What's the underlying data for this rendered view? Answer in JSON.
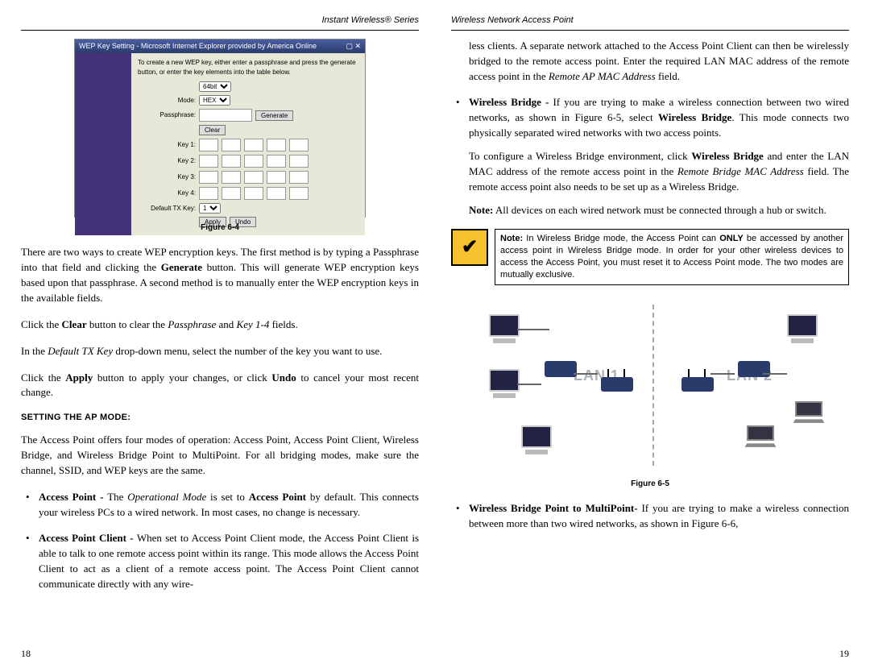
{
  "header": {
    "left": "Instant Wireless® Series",
    "right": "Wireless Network Access Point"
  },
  "left_page": {
    "wep_window_title": "WEP Key Setting - Microsoft Internet Explorer provided by America Online",
    "wep_instruction": "To create a new WEP key, either enter a passphrase and press the generate button, or enter the key elements into the table below.",
    "wep_labels": {
      "bit": "64bit",
      "mode": "Mode:",
      "mode_val": "HEX",
      "passphrase": "Passphrase:",
      "generate": "Generate",
      "clear": "Clear",
      "key1": "Key 1:",
      "key2": "Key 2:",
      "key3": "Key 3:",
      "key4": "Key 4:",
      "default_tx": "Default TX Key:",
      "apply": "Apply",
      "undo": "Undo"
    },
    "fig64": "Figure 6-4",
    "p1a": "There are two ways to create WEP encryption keys. The first method is by typing a Passphrase into that field and clicking the ",
    "p1b": "Generate",
    "p1c": " button. This will generate WEP encryption keys based upon that passphrase. A second method is to manually enter the WEP encryption keys in the available fields.",
    "p2a": "Click the ",
    "p2b": "Clear",
    "p2c": " button to clear the ",
    "p2d": "Passphrase",
    "p2e": " and ",
    "p2f": "Key 1-4",
    "p2g": " fields.",
    "p3a": "In the ",
    "p3b": "Default TX Key",
    "p3c": " drop-down menu, select the number of the key you want to use.",
    "p4a": "Click the ",
    "p4b": "Apply",
    "p4c": " button to apply your changes, or click ",
    "p4d": "Undo",
    "p4e": " to cancel your most recent change.",
    "section": "SETTING THE AP MODE:",
    "p5": "The Access Point offers four modes of operation: Access Point, Access Point Client, Wireless Bridge, and Wireless Bridge Point to MultiPoint. For all bridging modes, make sure the channel, SSID, and WEP keys are the same.",
    "b1a": "Access Point - ",
    "b1b": "The ",
    "b1c": "Operational Mode",
    "b1d": " is set to ",
    "b1e": "Access Point",
    "b1f": " by default. This connects your wireless PCs to a wired network. In most cases, no change is necessary.",
    "b2a": "Access Point Client - ",
    "b2b": "When set to Access Point Client mode, the Access Point Client is able to talk to one remote access point within its range. This mode allows the Access Point Client to act as a client of a remote access point. The Access Point Client cannot communicate directly with any wire-",
    "pagenum": "18"
  },
  "right_page": {
    "cont1a": "less clients. A separate network attached to the Access Point Client can then be wirelessly bridged to the remote access point. Enter the required LAN MAC address of the remote access point in the ",
    "cont1b": "Remote AP MAC Address",
    "cont1c": " field.",
    "b3a": "Wireless Bridge - ",
    "b3b": "If you are trying to make a wireless connection between two wired networks, as shown in Figure 6-5, select ",
    "b3c": "Wireless Bridge",
    "b3d": ". This mode connects two physically separated wired networks with two access points.",
    "b3p2a": "To configure a Wireless Bridge environment, click ",
    "b3p2b": "Wireless Bridge",
    "b3p2c": " and enter the LAN MAC address of the remote access point in the ",
    "b3p2d": "Remote Bridge MAC Address",
    "b3p2e": " field. The remote access point also needs to be set up as a Wireless Bridge.",
    "b3p3a": "Note:",
    "b3p3b": " All devices on each wired network must be connected through a hub or switch.",
    "warn_a": "Note:",
    "warn_b": " In Wireless Bridge mode, the Access Point can ",
    "warn_c": "ONLY",
    "warn_d": " be accessed by another access point in Wireless Bridge mode. In order for your other wireless devices to access the Access Point, you must reset it to Access Point mode. The two modes are mutually exclusive.",
    "lan1": "LAN 1",
    "lan2": "LAN 2",
    "fig65": "Figure 6-5",
    "b4a": "Wireless Bridge Point to MultiPoint- ",
    "b4b": "If you are trying to make a wireless connection between more than two wired networks, as shown in Figure 6-6,",
    "pagenum": "19"
  }
}
